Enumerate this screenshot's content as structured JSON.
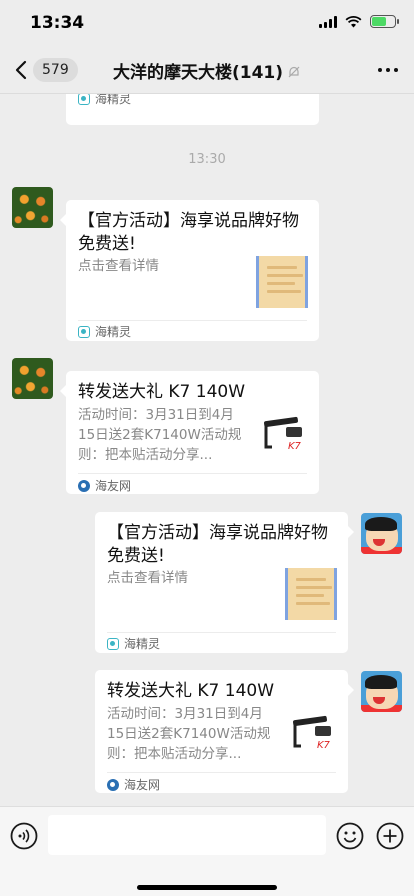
{
  "status_bar": {
    "time": "13:34"
  },
  "nav": {
    "unread_count": "579",
    "title": "大洋的摩天大楼(141)"
  },
  "colors": {
    "accent_green": "#4cd964",
    "background": "#ededed",
    "bubble": "#ffffff",
    "source_text": "#666666"
  },
  "battery_level": 0.65,
  "messages": [
    {
      "type": "card-partial",
      "side": "left",
      "source": "海精灵"
    },
    {
      "type": "timestamp",
      "text": "13:30"
    },
    {
      "type": "card",
      "side": "left",
      "avatar": "flower-avatar",
      "title": "【官方活动】海享说品牌好物免费送!",
      "desc": "点击查看详情",
      "source": "海精灵",
      "thumb": "promo-thumbnail"
    },
    {
      "type": "card",
      "side": "left",
      "avatar": "flower-avatar",
      "title": "转发送大礼 K7 140W",
      "desc": "活动时间：3月31日到4月15日送2套K7140W活动规则：把本贴活动分享...",
      "source": "海友网",
      "thumb": "aquarium-light-thumbnail"
    },
    {
      "type": "card",
      "side": "right",
      "avatar": "shin-chan-avatar",
      "title": "【官方活动】海享说品牌好物免费送!",
      "desc": "点击查看详情",
      "source": "海精灵",
      "thumb": "promo-thumbnail"
    },
    {
      "type": "card",
      "side": "right",
      "avatar": "shin-chan-avatar",
      "title": "转发送大礼 K7 140W",
      "desc": "活动时间：3月31日到4月15日送2套K7140W活动规则：把本贴活动分享...",
      "source": "海友网",
      "thumb": "aquarium-light-thumbnail"
    }
  ],
  "input_bar": {
    "placeholder": "",
    "icons": [
      "voice-icon",
      "emoji-icon",
      "plus-icon"
    ]
  }
}
